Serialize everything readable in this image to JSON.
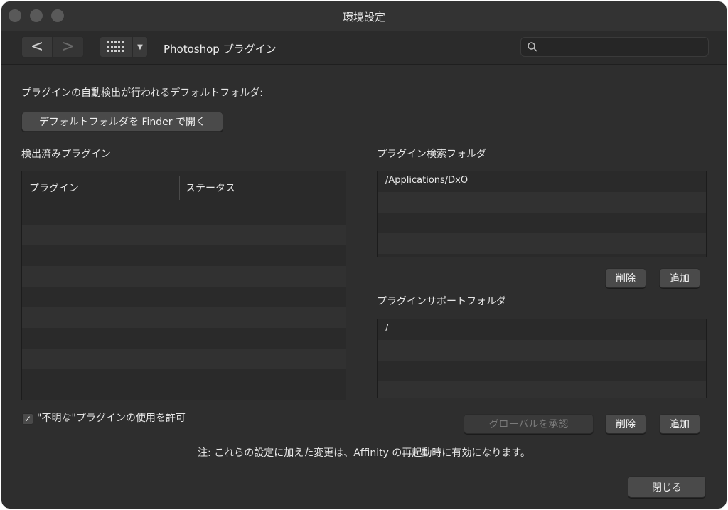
{
  "window": {
    "title": "環境設定"
  },
  "toolbar": {
    "back_glyph": "<",
    "forward_glyph": ">",
    "grid_icon": "grid-icon",
    "dropdown_glyph": "▼",
    "section_title": "Photoshop プラグイン",
    "search_placeholder": ""
  },
  "main": {
    "default_folder_label": "プラグインの自動検出が行われるデフォルトフォルダ:",
    "open_in_finder_label": "デフォルトフォルダを Finder で開く",
    "detected_plugins_label": "検出済みプラグイン",
    "columns": [
      "プラグイン",
      "ステータス"
    ],
    "search_folders_label": "プラグイン検索フォルダ",
    "search_folders": [
      "/Applications/DxO"
    ],
    "support_folders_label": "プラグインサポートフォルダ",
    "support_folders": [
      "/"
    ],
    "remove_label": "削除",
    "add_label": "追加",
    "global_approve_label": "グローバルを承認",
    "allow_unknown_label": "\"不明な\"プラグインの使用を許可",
    "allow_unknown_checked": true,
    "note": "注: これらの設定に加えた変更は、Affinity の再起動時に有効になります。",
    "close_label": "閉じる"
  }
}
